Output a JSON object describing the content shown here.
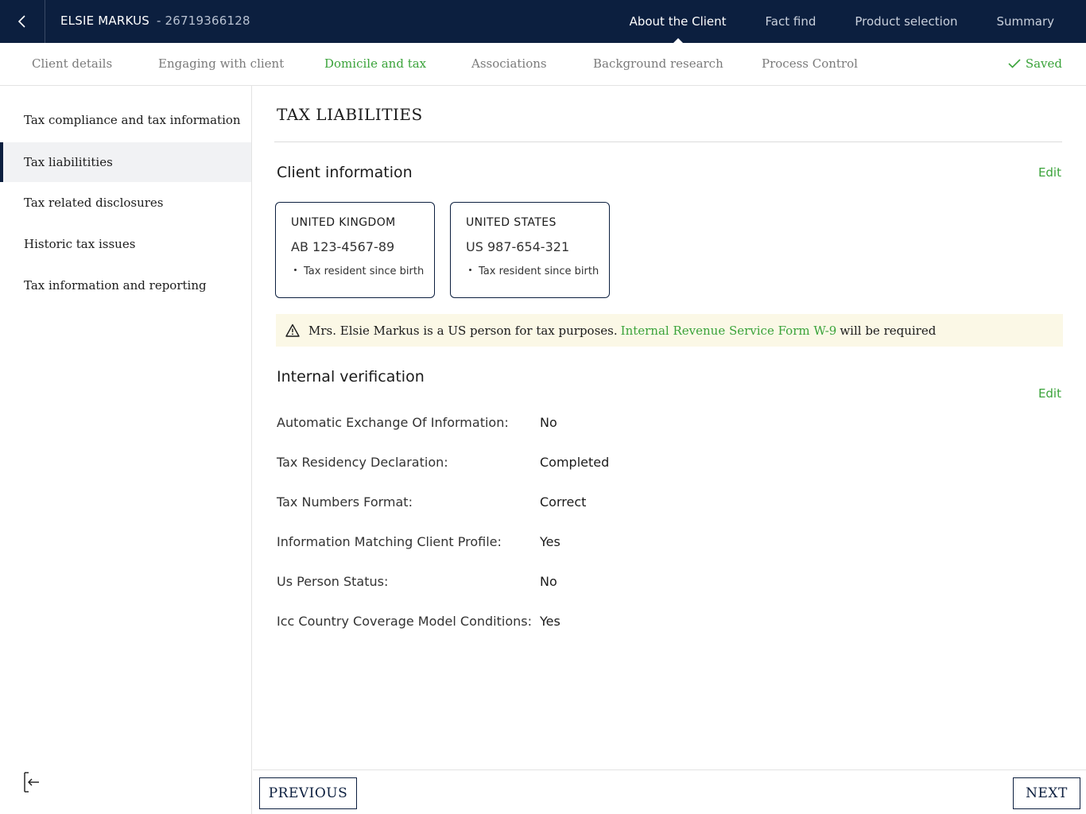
{
  "header": {
    "client_name": "ELSIE MARKUS",
    "client_id": "- 26719366128",
    "nav": [
      {
        "label": "About the Client",
        "active": true
      },
      {
        "label": "Fact find",
        "active": false
      },
      {
        "label": "Product selection",
        "active": false
      },
      {
        "label": "Summary",
        "active": false
      }
    ]
  },
  "subnav": {
    "tabs": [
      {
        "label": "Client details"
      },
      {
        "label": "Engaging with client"
      },
      {
        "label": "Domicile and tax"
      },
      {
        "label": "Associations"
      },
      {
        "label": "Background research"
      },
      {
        "label": "Process Control"
      }
    ],
    "active_tab": "Domicile and tax",
    "saved_label": "Saved"
  },
  "sidebar": {
    "items": [
      {
        "label": "Tax compliance and tax information"
      },
      {
        "label": "Tax liabilitities"
      },
      {
        "label": "Tax related disclosures"
      },
      {
        "label": "Historic tax issues"
      },
      {
        "label": "Tax information and reporting"
      }
    ],
    "active_item": "Tax liabilitities"
  },
  "main": {
    "title": "TAX LIABILITIES",
    "client_info": {
      "heading": "Client information",
      "edit_label": "Edit",
      "cards": [
        {
          "country": "UNITED KINGDOM",
          "tax_number": "AB 123-4567-89",
          "note": "Tax resident since birth"
        },
        {
          "country": "UNITED STATES",
          "tax_number": "US 987-654-321",
          "note": "Tax resident since birth"
        }
      ]
    },
    "alert": {
      "text_before": "Mrs. Elsie Markus is a US person for tax purposes.",
      "link_text": "Internal Revenue Service Form W-9",
      "text_after": "will be required"
    },
    "verification": {
      "heading": "Internal verification",
      "edit_label": "Edit",
      "rows": [
        {
          "label": "Automatic Exchange Of Information:",
          "value": "No"
        },
        {
          "label": "Tax Residency Declaration:",
          "value": "Completed"
        },
        {
          "label": "Tax Numbers Format:",
          "value": "Correct"
        },
        {
          "label": "Information Matching Client Profile:",
          "value": "Yes"
        },
        {
          "label": "Us Person Status:",
          "value": "No"
        },
        {
          "label": "Icc Country Coverage Model Conditions:",
          "value": "Yes"
        }
      ]
    }
  },
  "footer": {
    "previous_label": "PREVIOUS",
    "next_label": "NEXT"
  },
  "colors": {
    "header_bg": "#0c1f3f",
    "accent_green": "#3aa33a",
    "alert_bg": "#fbf8e6"
  }
}
